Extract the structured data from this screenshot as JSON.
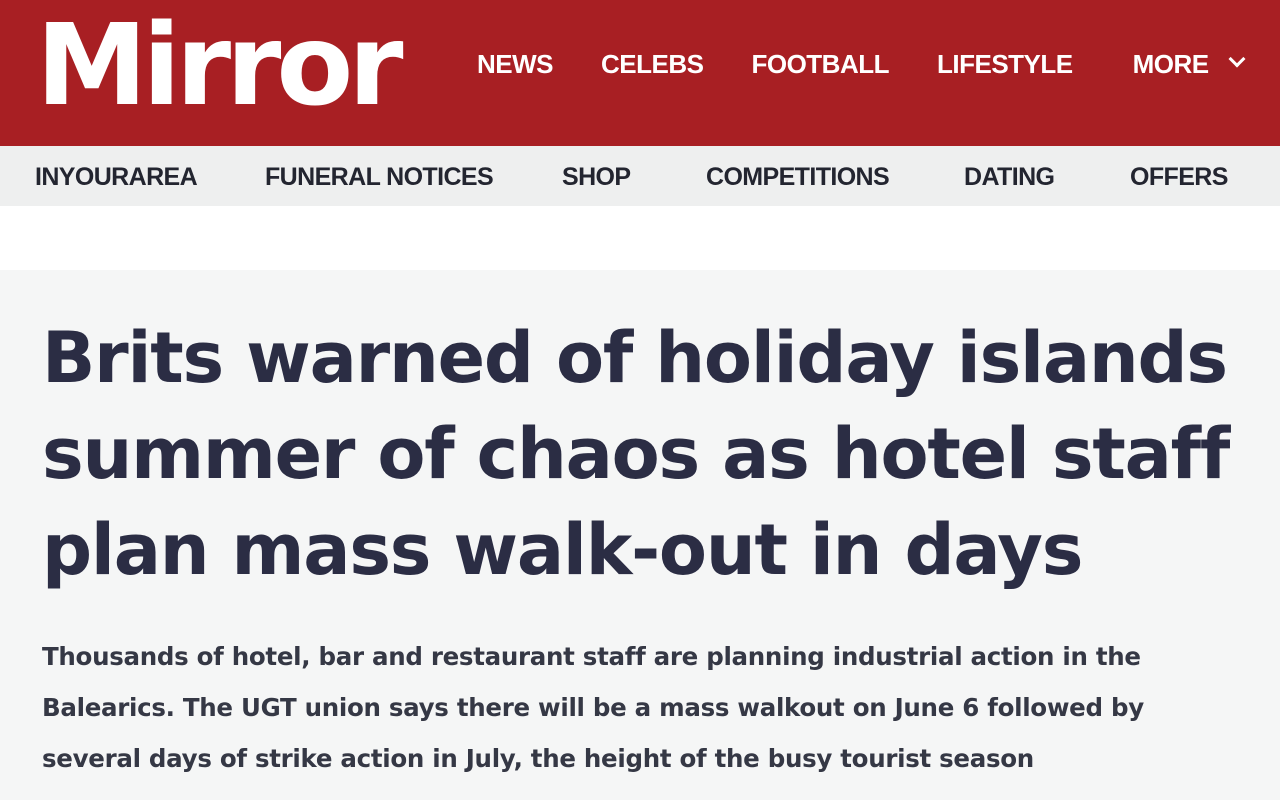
{
  "brand": {
    "logo_text": "Mirror",
    "color": "#a81f23"
  },
  "primary_nav": {
    "items": [
      {
        "label": "NEWS"
      },
      {
        "label": "CELEBS"
      },
      {
        "label": "FOOTBALL"
      },
      {
        "label": "LIFESTYLE"
      }
    ],
    "more_label": "MORE",
    "more_icon": "chevron-down-icon"
  },
  "secondary_nav": {
    "items": [
      {
        "label": "INYOURAREA"
      },
      {
        "label": "FUNERAL NOTICES"
      },
      {
        "label": "SHOP"
      },
      {
        "label": "COMPETITIONS"
      },
      {
        "label": "DATING"
      },
      {
        "label": "OFFERS"
      }
    ]
  },
  "article": {
    "headline": "Brits warned of holiday islands summer of chaos as hotel staff plan mass walk-out in days",
    "standfirst": "Thousands of hotel, bar and restaurant staff are planning industrial action in the Balearics. The UGT union says there will be a mass walkout on June 6 followed by several days of strike action in July, the height of the busy tourist season"
  },
  "colors": {
    "headline_text": "#2b2d44",
    "nav_text_on_red": "#ffffff",
    "subnav_text": "#232530",
    "page_background": "#f5f6f6"
  }
}
